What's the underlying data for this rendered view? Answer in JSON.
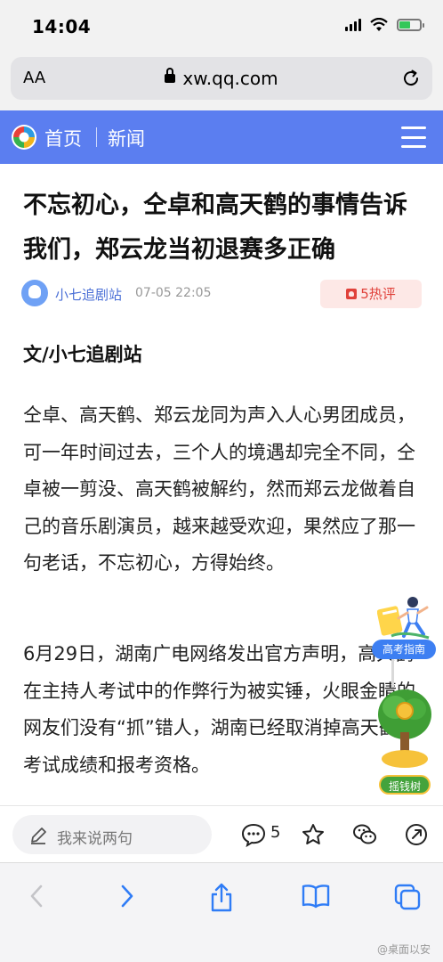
{
  "status_bar": {
    "time": "14:04"
  },
  "browser": {
    "aa_label": "AA",
    "url": "xw.qq.com"
  },
  "nav": {
    "home": "首页",
    "news": "新闻"
  },
  "article": {
    "title": "不忘初心，仝卓和高天鹤的事情告诉我们，郑云龙当初退赛多正确",
    "author": "小七追剧站",
    "date": "07-05 22:05",
    "hot_comments": "5热评",
    "byline": "文/小七追剧站",
    "paragraph_1": "仝卓、高天鹤、郑云龙同为声入人心男团成员，可一年时间过去，三个人的境遇却完全不同，仝卓被一剪没、高天鹤被解约，然而郑云龙做着自己的音乐剧演员，越来越受欢迎，果然应了那一句老话，不忘初心，方得始终。",
    "paragraph_2": "6月29日，湖南广电网络发出官方声明，高天鹤在主持人考试中的作弊行为被实锤，火眼金睛的网友们没有“抓”错人，湖南已经取消掉高天鹤的考试成绩和报考资格。"
  },
  "floating": {
    "guide_label": "高考指南",
    "tree_label": "摇钱树"
  },
  "comment_bar": {
    "placeholder": "我来说两句",
    "comment_count": "5"
  },
  "watermark": "@桌面以安",
  "colors": {
    "nav_blue": "#5b7ef0",
    "link_blue": "#4a6fd6",
    "hot_red": "#e0413a",
    "toolbar_blue": "#2f7cf6"
  },
  "icons": [
    "lock-icon",
    "reload-icon",
    "qq-news-logo",
    "menu-icon",
    "flame-icon",
    "pencil-icon",
    "comment-icon",
    "star-icon",
    "wechat-icon",
    "share-icon",
    "back-icon",
    "forward-icon",
    "share-upload-icon",
    "bookmarks-icon",
    "tabs-icon"
  ]
}
